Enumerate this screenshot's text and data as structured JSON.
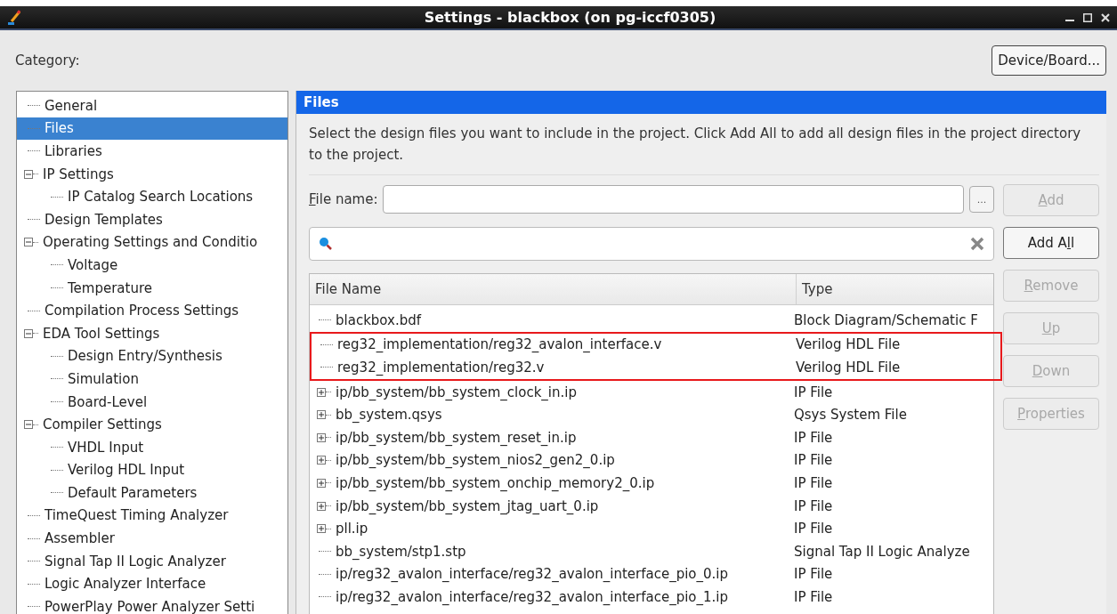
{
  "window": {
    "title": "Settings - blackbox (on pg-iccf0305)"
  },
  "category_label": "Category:",
  "device_button": {
    "label": "Device/Board..."
  },
  "category_tree": [
    {
      "label": "General",
      "selected": false
    },
    {
      "label": "Files",
      "selected": true
    },
    {
      "label": "Libraries",
      "selected": false
    },
    {
      "label": "IP Settings",
      "selected": false,
      "expanded": true,
      "children": [
        {
          "label": "IP Catalog Search Locations",
          "selected": false
        }
      ]
    },
    {
      "label": "Design Templates",
      "selected": false
    },
    {
      "label": "Operating Settings and Conditio",
      "selected": false,
      "expanded": true,
      "children": [
        {
          "label": "Voltage",
          "selected": false
        },
        {
          "label": "Temperature",
          "selected": false
        }
      ]
    },
    {
      "label": "Compilation Process Settings",
      "selected": false
    },
    {
      "label": "EDA Tool Settings",
      "selected": false,
      "expanded": true,
      "children": [
        {
          "label": "Design Entry/Synthesis",
          "selected": false
        },
        {
          "label": "Simulation",
          "selected": false
        },
        {
          "label": "Board-Level",
          "selected": false
        }
      ]
    },
    {
      "label": "Compiler Settings",
      "selected": false,
      "expanded": true,
      "children": [
        {
          "label": "VHDL Input",
          "selected": false
        },
        {
          "label": "Verilog HDL Input",
          "selected": false
        },
        {
          "label": "Default Parameters",
          "selected": false
        }
      ]
    },
    {
      "label": "TimeQuest Timing Analyzer",
      "selected": false
    },
    {
      "label": "Assembler",
      "selected": false
    },
    {
      "label": "Signal Tap II Logic Analyzer",
      "selected": false
    },
    {
      "label": "Logic Analyzer Interface",
      "selected": false
    },
    {
      "label": "PowerPlay Power Analyzer Setti",
      "selected": false
    }
  ],
  "panel": {
    "title": "Files",
    "description": "Select the design files you want to include in the project. Click Add All to add all design files in the project directory to the project.",
    "file_name": {
      "label_key": "F",
      "label_rest": "ile name:",
      "browse": "..."
    },
    "table": {
      "columns": [
        "File Name",
        "Type"
      ],
      "rows": [
        {
          "name": "blackbox.bdf",
          "type": "Block Diagram/Schematic F",
          "expandable": false,
          "marked": false
        },
        {
          "name": "reg32_implementation/reg32_avalon_interface.v",
          "type": "Verilog HDL File",
          "expandable": false,
          "marked": true
        },
        {
          "name": "reg32_implementation/reg32.v",
          "type": "Verilog HDL File",
          "expandable": false,
          "marked": true
        },
        {
          "name": "ip/bb_system/bb_system_clock_in.ip",
          "type": "IP File",
          "expandable": true,
          "marked": false
        },
        {
          "name": "bb_system.qsys",
          "type": "Qsys System File",
          "expandable": true,
          "marked": false
        },
        {
          "name": "ip/bb_system/bb_system_reset_in.ip",
          "type": "IP File",
          "expandable": true,
          "marked": false
        },
        {
          "name": "ip/bb_system/bb_system_nios2_gen2_0.ip",
          "type": "IP File",
          "expandable": true,
          "marked": false
        },
        {
          "name": "ip/bb_system/bb_system_onchip_memory2_0.ip",
          "type": "IP File",
          "expandable": true,
          "marked": false
        },
        {
          "name": "ip/bb_system/bb_system_jtag_uart_0.ip",
          "type": "IP File",
          "expandable": true,
          "marked": false
        },
        {
          "name": "pll.ip",
          "type": "IP File",
          "expandable": true,
          "marked": false
        },
        {
          "name": "bb_system/stp1.stp",
          "type": "Signal Tap II Logic Analyze",
          "expandable": false,
          "marked": false
        },
        {
          "name": "ip/reg32_avalon_interface/reg32_avalon_interface_pio_0.ip",
          "type": "IP File",
          "expandable": false,
          "marked": false
        },
        {
          "name": "ip/reg32_avalon_interface/reg32_avalon_interface_pio_1.ip",
          "type": "IP File",
          "expandable": false,
          "marked": false
        }
      ]
    },
    "buttons": [
      {
        "key": "A",
        "rest": "dd",
        "disabled": true
      },
      {
        "pre": "Add A",
        "key": "l",
        "rest": "l",
        "disabled": false
      },
      {
        "key": "R",
        "rest": "emove",
        "disabled": true
      },
      {
        "key": "U",
        "rest": "p",
        "disabled": true
      },
      {
        "key": "D",
        "rest": "own",
        "disabled": true
      },
      {
        "key": "P",
        "rest": "roperties",
        "disabled": true
      }
    ]
  }
}
